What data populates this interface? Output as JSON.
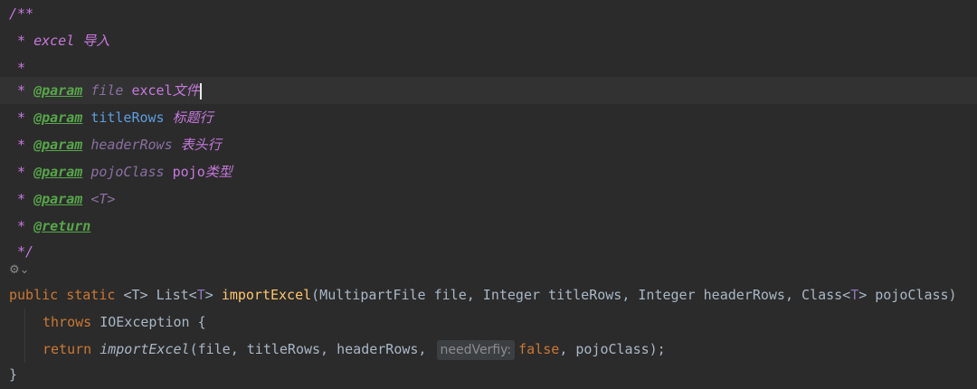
{
  "doc": {
    "open": "/**",
    "star": "*",
    "summary": "excel",
    "summary_cn": "导入",
    "param_tag": "@param",
    "return_tag": "@return",
    "close": "*/",
    "params": [
      {
        "name": "file",
        "desc_en": "excel",
        "desc_cn": "文件"
      },
      {
        "name": "titleRows",
        "desc_cn": "标题行"
      },
      {
        "name": "headerRows",
        "desc_cn": "表头行"
      },
      {
        "name": "pojoClass",
        "desc_en": "pojo",
        "desc_cn": "类型"
      },
      {
        "name": "<T>"
      }
    ]
  },
  "gutter": {
    "icon": "annotation-gutter-icon",
    "chevron": "chevron-down-icon"
  },
  "code": {
    "public": "public",
    "static": "static",
    "generic": "<T>",
    "list": "List<",
    "T": "T",
    "gt": ">",
    "method": "importExcel",
    "sig_rest1": "(MultipartFile file, Integer titleRows, Integer headerRows, Class<",
    "sig_rest2": "> pojoClass)",
    "throws": "throws",
    "exception": "IOException {",
    "return": "return",
    "call_args": "(file, titleRows, headerRows, ",
    "hint": "needVerfiy:",
    "false": "false",
    "call_end": ", pojoClass);",
    "close_brace": "}"
  }
}
